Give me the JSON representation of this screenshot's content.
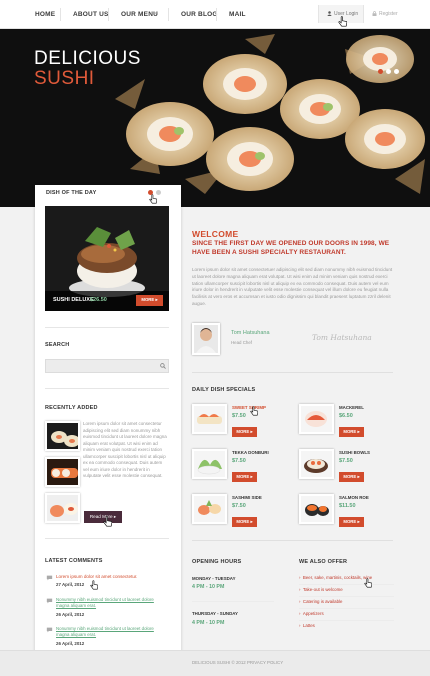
{
  "nav": {
    "items": [
      "HOME",
      "ABOUT US",
      "OUR MENU",
      "OUR BLOG",
      "MAIL"
    ],
    "login": "User Login",
    "register": "Register"
  },
  "hero": {
    "line1": "DELICIOUS",
    "line2": "SUSHI"
  },
  "dish_of_day": {
    "title": "DISH OF THE DAY",
    "name": "SUSHI DELUXE",
    "price": "$26.50",
    "button": "MORE"
  },
  "search": {
    "title": "SEARCH",
    "placeholder": ""
  },
  "recent": {
    "title": "RECENTLY ADDED",
    "text": "Lorem ipsum dolor sit amet consectetur adipiscing elit sed diam nonummy nibh euismod tincidunt ut laoreet dolore magna aliquam erat volutpat. Ut wisi enim ad minim veniam quis nostrud exerci tation ullamcorper suscipit lobortis nisl ut aliquip ex ea commodo consequat. Duis autem vel eum iriure dolor in hendrerit in vulputate velit esse molestie consequat.",
    "button": "Read More"
  },
  "comments": {
    "title": "LATEST COMMENTS",
    "items": [
      {
        "text": "Lorem ipsum dolor sit amet consectetur.",
        "date": "27 April, 2012"
      },
      {
        "text": "Nonummy nibh euismod tincidunt ut laoreet dolore magna aliquam erat.",
        "date": "26 April, 2012"
      },
      {
        "text": "Nonummy nibh euismod tincidunt ut laoreet dolore magna aliquam erat.",
        "date": "26 April, 2012"
      }
    ]
  },
  "welcome": {
    "title": "WELCOME",
    "tagline": "SINCE THE FIRST DAY WE OPENED OUR DOORS IN 1998, WE HAVE BEEN A SUSHI SPECIALTY RESTAURANT.",
    "body": "Lorem ipsum dolor sit amet consectetuer adipiscing elit sed diam nonummy nibh euismod tincidunt ut laoreet dolore magna aliquam erat volutpat. Ut wisi enim ad minim veniam quis nostrud exerci tation ullamcorper suscipit lobortis nisl ut aliquip ex ea commodo consequat. Duis autem vel eum iriure dolor in hendrerit in vulputate velit esse molestie consequat vel illum dolore eu feugiat nulla facilisis at vero eros et accumsan et iusto odio dignissim qui blandit praesent luptatum zzril delenit augue.",
    "chef_name": "Tom Hatsuhana",
    "chef_role": "Head Chef",
    "signature": "Tom Hatsuhana"
  },
  "specials": {
    "title": "DAILY DISH SPECIALS",
    "items": [
      {
        "name": "SWEET SHRIMP",
        "price": "$7.50",
        "button": "MORE"
      },
      {
        "name": "MACKEREL",
        "price": "$6.50",
        "button": "MORE"
      },
      {
        "name": "TEKKA DONBURI",
        "price": "$7.50",
        "button": "MORE"
      },
      {
        "name": "SUSHI BOWLS",
        "price": "$7.50",
        "button": "MORE"
      },
      {
        "name": "SASHIMI SIDE",
        "price": "$7.50",
        "button": "MORE"
      },
      {
        "name": "SALMON ROE",
        "price": "$11.50",
        "button": "MORE"
      }
    ]
  },
  "hours": {
    "title": "OPENING HOURS",
    "blocks": [
      {
        "days": "MONDAY - TUESDAY",
        "time": "4 PM - 10 PM"
      },
      {
        "days": "THURSDAY - SUNDAY",
        "time": "4 PM - 10 PM"
      }
    ]
  },
  "offer": {
    "title": "WE ALSO OFFER",
    "items": [
      "Beer, sake, martinis, cocktails, wine",
      "Take-out is welcome",
      "Catering is available",
      "Appetizers",
      "Lattes"
    ]
  },
  "footer": {
    "text": "DELICIOUS SUSHI © 2012 PRIVACY POLICY"
  },
  "colors": {
    "accent": "#d24c2d",
    "green": "#5aa67a",
    "dark": "#333333"
  }
}
